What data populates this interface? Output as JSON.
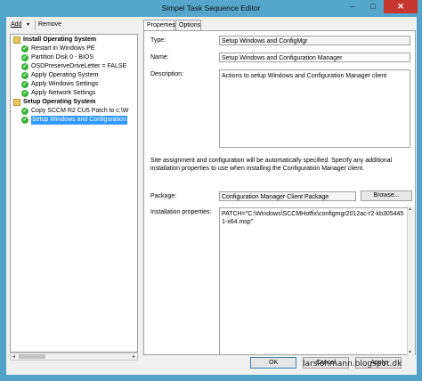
{
  "window": {
    "title": "Simpel Task Sequence Editor",
    "min_glyph": "‒",
    "max_glyph": "□",
    "close_glyph": "✕"
  },
  "toolbar": {
    "add_label": "Add",
    "add_arrow": "▾",
    "remove_label": "Remove"
  },
  "tree": {
    "items": [
      {
        "label": "Install Operating System",
        "kind": "group",
        "icon": "folder-icon"
      },
      {
        "label": "Restart in Windows PE",
        "kind": "step",
        "icon": "check-icon"
      },
      {
        "label": "Partition Disk 0 - BIOS",
        "kind": "step",
        "icon": "check-icon"
      },
      {
        "label": "OSDPreserveDriveLetter = FALSE",
        "kind": "step",
        "icon": "check-icon"
      },
      {
        "label": "Apply Operating System",
        "kind": "step",
        "icon": "check-icon"
      },
      {
        "label": "Apply Windows Settings",
        "kind": "step",
        "icon": "check-icon"
      },
      {
        "label": "Apply Network Settings",
        "kind": "step",
        "icon": "check-icon"
      },
      {
        "label": "Setup Operating System",
        "kind": "group",
        "icon": "folder-icon"
      },
      {
        "label": "Copy SCCM R2 CU5 Patch to c:\\W",
        "kind": "step",
        "icon": "check-icon"
      },
      {
        "label": "Setup Windows and Configuration",
        "kind": "step",
        "icon": "check-icon",
        "selected": true
      }
    ],
    "scroll_left": "◂",
    "scroll_right": "▸"
  },
  "tabs": {
    "properties": "Properties",
    "options": "Options"
  },
  "properties": {
    "type_label": "Type:",
    "type_value": "Setup Windows and ConfigMgr",
    "name_label": "Name:",
    "name_value": "Setup Windows and Configuration Manager",
    "description_label": "Description:",
    "description_value": "Actions to setup Windows and Configuration Manager client",
    "info_text": "Site assignment and configuration will be automatically specified. Specify any additional installation properties to use when installing the Configuration Manager client.",
    "package_label": "Package:",
    "package_value": "Configuration Manager Client Package",
    "browse_label": "Browse...",
    "install_props_label": "Installation properties:",
    "install_props_value": "PATCH=\"C:\\Windows\\SCCMHotfix\\configmgr2012ac-r2-kb3054451-x64.msp\"",
    "scroll_up": "▴",
    "scroll_down": "▾"
  },
  "buttons": {
    "ok": "OK",
    "cancel": "Cancel",
    "apply": "Apply"
  },
  "watermark": "larslohmann.blogspot.dk",
  "colors": {
    "accent": "#51a2c7",
    "selection": "#3399ff",
    "close": "#c7372f"
  }
}
